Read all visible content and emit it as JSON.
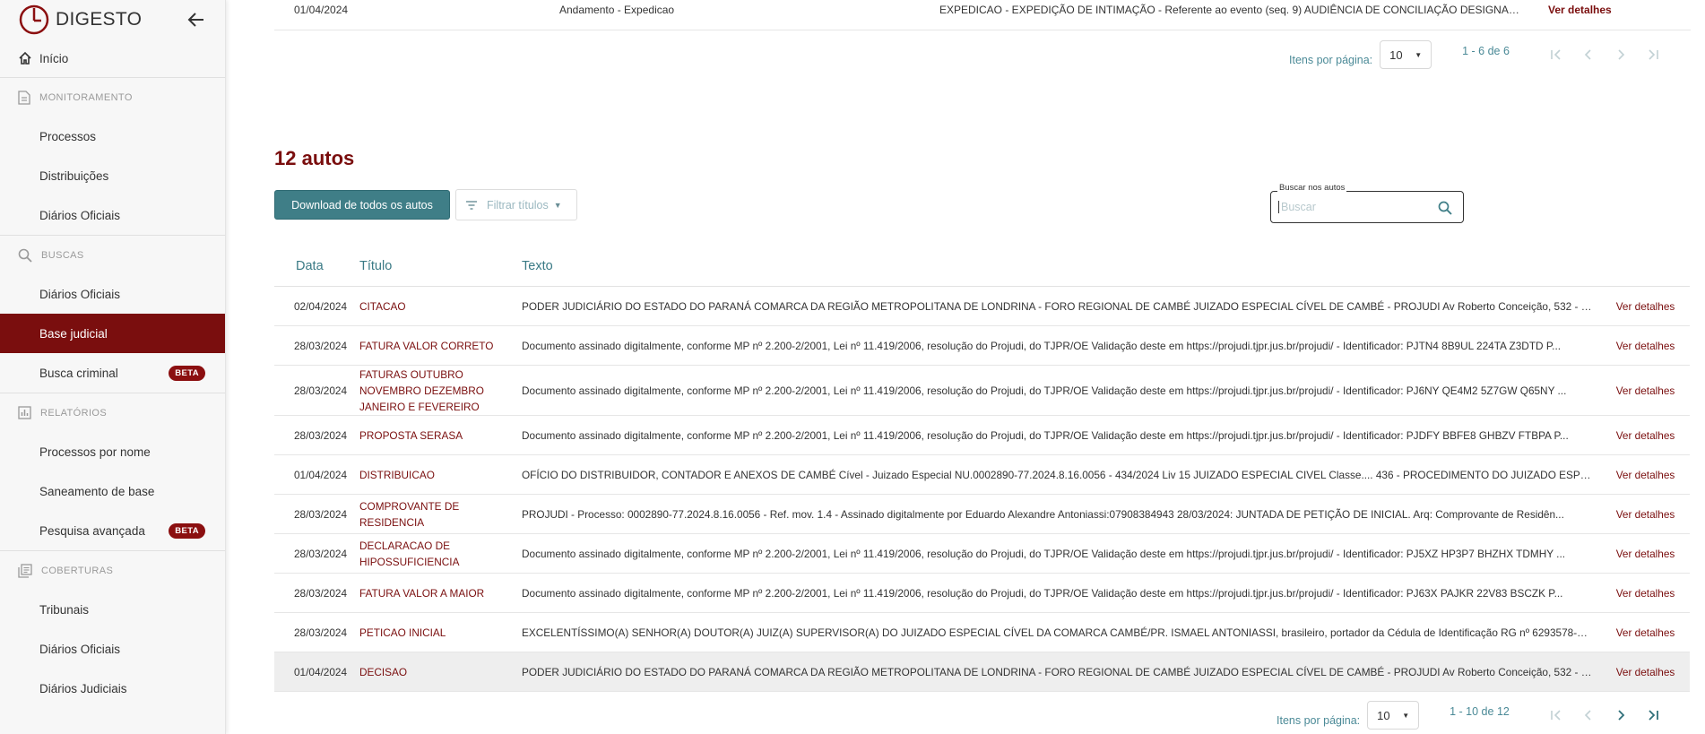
{
  "brand": {
    "name": "DIGESTO"
  },
  "sidebar": {
    "home": "Início",
    "sections": [
      {
        "title": "MONITORAMENTO",
        "icon": "document-icon",
        "items": [
          {
            "label": "Processos"
          },
          {
            "label": "Distribuições"
          },
          {
            "label": "Diários Oficiais"
          }
        ]
      },
      {
        "title": "BUSCAS",
        "icon": "search-icon",
        "items": [
          {
            "label": "Diários Oficiais"
          },
          {
            "label": "Base judicial",
            "active": true
          },
          {
            "label": "Busca criminal",
            "badge": "BETA"
          }
        ]
      },
      {
        "title": "RELATÓRIOS",
        "icon": "chart-icon",
        "items": [
          {
            "label": "Processos por nome"
          },
          {
            "label": "Saneamento de base"
          },
          {
            "label": "Pesquisa avançada",
            "badge": "BETA"
          }
        ]
      },
      {
        "title": "COBERTURAS",
        "icon": "library-icon",
        "items": [
          {
            "label": "Tribunais"
          },
          {
            "label": "Diários Oficiais"
          },
          {
            "label": "Diários Judiciais"
          }
        ]
      }
    ]
  },
  "top_table": {
    "last_row": {
      "date": "01/04/2024",
      "type": "Andamento - Expedicao",
      "text": "EXPEDICAO - EXPEDIÇÃO DE INTIMAÇÃO - Referente ao evento (seq. 9) AUDIÊNCIA DE CONCILIAÇÃO DESIGNADA...",
      "action": "Ver detalhes"
    },
    "pager": {
      "items_label": "Itens por página:",
      "per_page": "10",
      "range": "1 - 6 de 6"
    }
  },
  "autos": {
    "title": "12 autos",
    "download_label": "Download de todos os autos",
    "filter_label": "Filtrar títulos",
    "search": {
      "label": "Buscar nos autos",
      "placeholder": "Buscar"
    },
    "columns": {
      "date": "Data",
      "title": "Título",
      "text": "Texto"
    },
    "rows": [
      {
        "date": "02/04/2024",
        "title": "CITACAO",
        "text": "PODER JUDICIÁRIO DO ESTADO DO PARANÁ COMARCA DA REGIÃO METROPOLITANA DE LONDRINA - FORO REGIONAL DE CAMBÉ JUIZADO ESPECIAL CÍVEL DE CAMBÉ - PROJUDI Av Roberto Conceição, 532 - 4° ...",
        "action": "Ver detalhes"
      },
      {
        "date": "28/03/2024",
        "title": "FATURA VALOR CORRETO",
        "text": "Documento assinado digitalmente, conforme MP nº 2.200-2/2001, Lei nº 11.419/2006, resolução do Projudi, do TJPR/OE Validação deste em https://projudi.tjpr.jus.br/projudi/ - Identificador: PJTN4 8B9UL 224TA Z3DTD P...",
        "action": "Ver detalhes"
      },
      {
        "date": "28/03/2024",
        "title": "FATURAS OUTUBRO NOVEMBRO DEZEMBRO JANEIRO E FEVEREIRO",
        "text": "Documento assinado digitalmente, conforme MP nº 2.200-2/2001, Lei nº 11.419/2006, resolução do Projudi, do TJPR/OE Validação deste em https://projudi.tjpr.jus.br/projudi/ - Identificador: PJ6NY QE4M2 5Z7GW Q65NY ...",
        "action": "Ver detalhes"
      },
      {
        "date": "28/03/2024",
        "title": "PROPOSTA SERASA",
        "text": "Documento assinado digitalmente, conforme MP nº 2.200-2/2001, Lei nº 11.419/2006, resolução do Projudi, do TJPR/OE Validação deste em https://projudi.tjpr.jus.br/projudi/ - Identificador: PJDFY BBFE8 GHBZV FTBPA P...",
        "action": "Ver detalhes"
      },
      {
        "date": "01/04/2024",
        "title": "DISTRIBUICAO",
        "text": "OFÍCIO DO DISTRIBUIDOR, CONTADOR E ANEXOS DE CAMBÉ Cível - Juizado Especial NU.0002890-77.2024.8.16.0056 - 434/2024 Liv 15 JUIZADO ESPECIAL CIVEL Classe.... 436 - PROCEDIMENTO DO JUIZADO ESPE...",
        "action": "Ver detalhes"
      },
      {
        "date": "28/03/2024",
        "title": "COMPROVANTE DE RESIDENCIA",
        "text": "PROJUDI - Processo: 0002890-77.2024.8.16.0056 - Ref. mov. 1.4 - Assinado digitalmente por Eduardo Alexandre Antoniassi:07908384943 28/03/2024: JUNTADA DE PETIÇÃO DE INICIAL. Arq: Comprovante de Residên...",
        "action": "Ver detalhes"
      },
      {
        "date": "28/03/2024",
        "title": "DECLARACAO DE HIPOSSUFICIENCIA",
        "text": "Documento assinado digitalmente, conforme MP nº 2.200-2/2001, Lei nº 11.419/2006, resolução do Projudi, do TJPR/OE Validação deste em https://projudi.tjpr.jus.br/projudi/ - Identificador: PJ5XZ HP3P7 BHZHX TDMHY ...",
        "action": "Ver detalhes"
      },
      {
        "date": "28/03/2024",
        "title": "FATURA VALOR A MAIOR",
        "text": "Documento assinado digitalmente, conforme MP nº 2.200-2/2001, Lei nº 11.419/2006, resolução do Projudi, do TJPR/OE Validação deste em https://projudi.tjpr.jus.br/projudi/ - Identificador: PJ63X PAJKR 22V83 BSCZK P...",
        "action": "Ver detalhes"
      },
      {
        "date": "28/03/2024",
        "title": "PETICAO INICIAL",
        "text": "EXCELENTÍSSIMO(A) SENHOR(A) DOUTOR(A) JUIZ(A) SUPERVISOR(A) DO JUIZADO ESPECIAL CÍVEL DA COMARCA CAMBÉ/PR. ISMAEL ANTONIASSI, brasileiro, portador da Cédula de Identificação RG nº 6293578-2 ...",
        "action": "Ver detalhes"
      },
      {
        "date": "01/04/2024",
        "title": "DECISAO",
        "text": "PODER JUDICIÁRIO DO ESTADO DO PARANÁ COMARCA DA REGIÃO METROPOLITANA DE LONDRINA - FORO REGIONAL DE CAMBÉ JUIZADO ESPECIAL CÍVEL DE CAMBÉ - PROJUDI Av Roberto Conceição, 532 - 4° ...",
        "action": "Ver detalhes",
        "highlighted": true
      }
    ],
    "pager": {
      "items_label": "Itens por página:",
      "per_page": "10",
      "range": "1 - 10 de 12"
    }
  },
  "colors": {
    "brand": "#7a0e0e",
    "accent": "#3f7e87",
    "teal_text": "#3a7a85"
  }
}
